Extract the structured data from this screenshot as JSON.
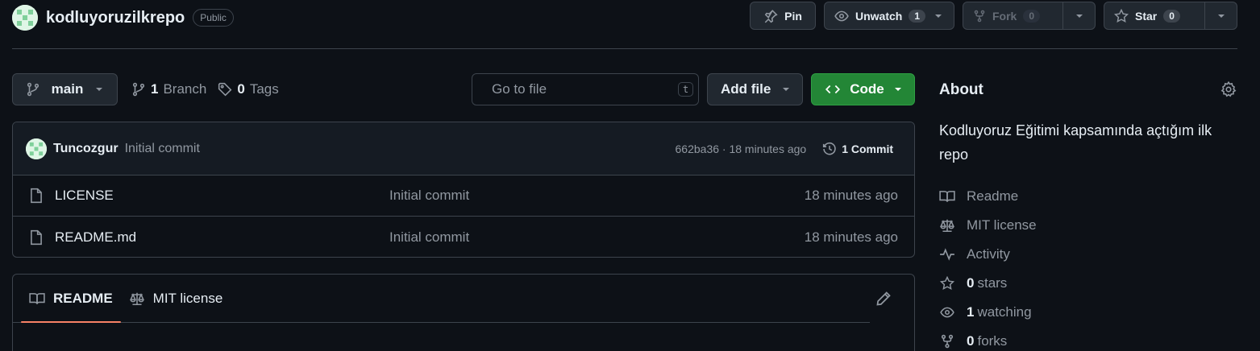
{
  "repo": {
    "name": "kodluyoruzilkrepo",
    "visibility": "Public"
  },
  "actions": {
    "pin_label": "Pin",
    "unwatch_label": "Unwatch",
    "watch_count": "1",
    "fork_label": "Fork",
    "fork_count": "0",
    "star_label": "Star",
    "star_count": "0"
  },
  "toolbar": {
    "branch": "main",
    "branch_count": "1",
    "branch_label": "Branch",
    "tag_count": "0",
    "tag_label": "Tags",
    "go_to_file_placeholder": "Go to file",
    "go_to_file_shortcut": "t",
    "add_file_label": "Add file",
    "code_label": "Code"
  },
  "latest_commit": {
    "author": "Tuncozgur",
    "message": "Initial commit",
    "meta": "662ba36 · 18 minutes ago",
    "commit_count_label": "1 Commit"
  },
  "files": [
    {
      "name": "LICENSE",
      "message": "Initial commit",
      "age": "18 minutes ago"
    },
    {
      "name": "README.md",
      "message": "Initial commit",
      "age": "18 minutes ago"
    }
  ],
  "readme_tabs": [
    {
      "label": "README"
    },
    {
      "label": "MIT license"
    }
  ],
  "about": {
    "title": "About",
    "description": "Kodluyoruz Eğitimi kapsamında açtığım ilk repo",
    "links": {
      "readme": "Readme",
      "license": "MIT license",
      "activity": "Activity",
      "stars_count": "0",
      "stars_label": "stars",
      "watching_count": "1",
      "watching_label": "watching",
      "forks_count": "0",
      "forks_label": "forks"
    }
  },
  "colors": {
    "background": "#0d1117",
    "border": "#3d444d",
    "code_button": "#238636",
    "tab_underline": "#f78166"
  }
}
